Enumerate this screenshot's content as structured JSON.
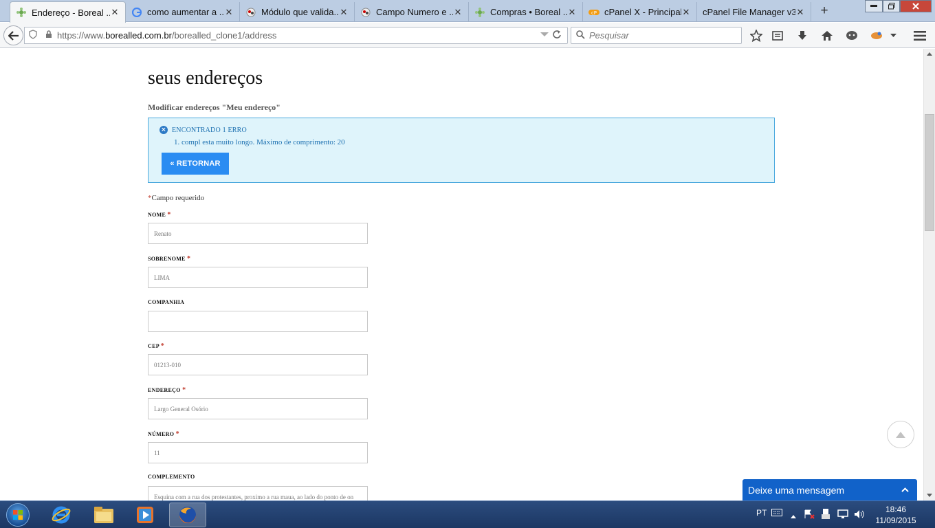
{
  "browser": {
    "tabs": [
      {
        "title": "Endereço - Boreal ...",
        "icon": "leaf-icon",
        "active": true
      },
      {
        "title": "como aumentar a ...",
        "icon": "google-icon",
        "active": false
      },
      {
        "title": "Módulo que valida...",
        "icon": "forum-icon",
        "active": false
      },
      {
        "title": "Campo Numero e ...",
        "icon": "forum-icon",
        "active": false
      },
      {
        "title": "Compras • Boreal ...",
        "icon": "leaf-icon",
        "active": false
      },
      {
        "title": "cPanel X - Principal",
        "icon": "cpanel-icon",
        "active": false
      },
      {
        "title": "cPanel File Manager v3",
        "icon": "",
        "active": false
      }
    ],
    "close_glyph": "✕",
    "new_tab": "+",
    "url_prefix": "https://www.",
    "url_domain": "borealled.com.br",
    "url_path": "/borealled_clone1/address",
    "search_placeholder": "Pesquisar"
  },
  "page": {
    "title": "seus endereços",
    "subtitle": "Modificar endereços \"Meu endereço\"",
    "alert": {
      "heading": "ENCONTRADO 1 ERRO",
      "items": [
        "1. compl esta muito longo. Máximo de comprimento: 20"
      ],
      "button": "« RETORNAR"
    },
    "required_note": "Campo requerido",
    "required_mark": "*",
    "fields": [
      {
        "label": "NOME",
        "required": true,
        "value": "Renato"
      },
      {
        "label": "SOBRENOME",
        "required": true,
        "value": "LIMA"
      },
      {
        "label": "COMPANHIA",
        "required": false,
        "value": ""
      },
      {
        "label": "CEP",
        "required": true,
        "value": "01213-010"
      },
      {
        "label": "ENDEREÇO",
        "required": true,
        "value": "Largo General Osório"
      },
      {
        "label": "NÚMERO",
        "required": true,
        "value": "11"
      },
      {
        "label": "COMPLEMENTO",
        "required": false,
        "value": "Esquina com a rua dos protestantes, proximo a rua maua, ao lado do ponto de on"
      }
    ],
    "chat_label": "Deixe uma mensagem"
  },
  "taskbar": {
    "language": "PT",
    "time": "18:46",
    "date": "11/09/2015"
  },
  "colors": {
    "tabstrip": "#bccde3",
    "alert_bg": "#dff4fb",
    "alert_border": "#47a7dd",
    "button_blue": "#2a8cf2",
    "chat_blue": "#1162c9",
    "required_red": "#c0392b"
  }
}
